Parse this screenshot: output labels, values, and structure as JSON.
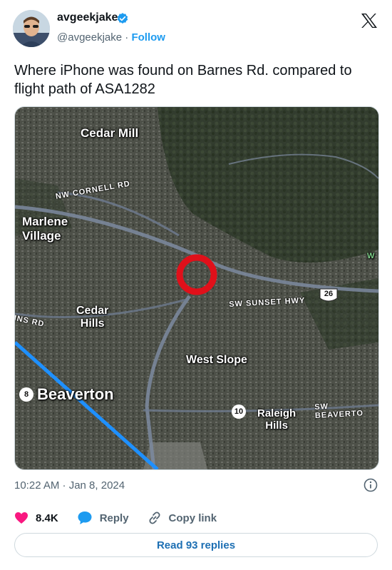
{
  "author": {
    "display_name": "avgeekjake",
    "handle": "@avgeekjake",
    "separator": "·",
    "follow_label": "Follow"
  },
  "tweet": {
    "text": "Where iPhone was found on Barnes Rd. compared to flight path of ASA1282"
  },
  "map": {
    "labels": {
      "cedar_mill": "Cedar Mill",
      "marlene_village": "Marlene\nVillage",
      "cedar_hills": "Cedar\nHills",
      "west_slope": "West Slope",
      "beaverton": "Beaverton",
      "raleigh_hills": "Raleigh\nHills",
      "cornell_rd": "NW CORNELL RD",
      "sunset_hwy": "SW SUNSET HWY",
      "beaverton_hwy": "SW BEAVERTO",
      "ins_rd": "INS RD",
      "w_edge": "W"
    },
    "shields": {
      "us26": "26",
      "route8": "8",
      "route10": "10"
    },
    "colors": {
      "flight_path": "#1e90ff",
      "marker": "#e0101a"
    }
  },
  "footer": {
    "timestamp": "10:22 AM · Jan 8, 2024",
    "likes": "8.4K",
    "reply_label": "Reply",
    "copy_link_label": "Copy link",
    "read_replies_label": "Read 93 replies",
    "like_color": "#f91880"
  }
}
